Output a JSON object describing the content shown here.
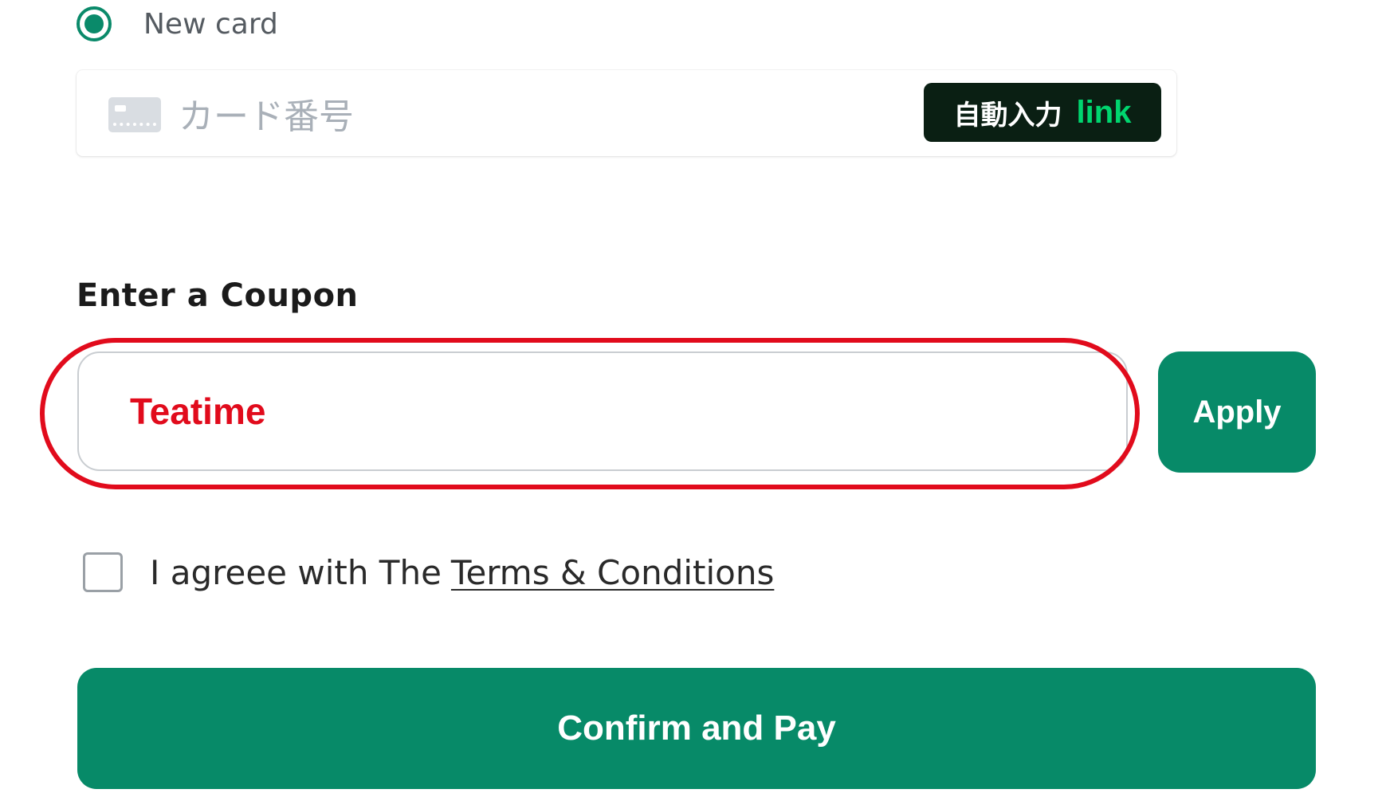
{
  "payment": {
    "new_card_label": "New card",
    "card_number_placeholder": "カード番号",
    "autofill_label": "自動入力",
    "link_label": "link"
  },
  "coupon": {
    "title": "Enter a Coupon",
    "value": "Teatime",
    "apply_label": "Apply"
  },
  "terms": {
    "prefix": "I agreee with The",
    "link_label": "Terms & Conditions"
  },
  "confirm_label": "Confirm and Pay",
  "colors": {
    "accent": "#078a68",
    "highlight": "#e10b1c",
    "link_brand": "#00d66f"
  }
}
